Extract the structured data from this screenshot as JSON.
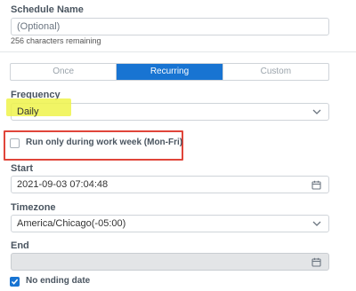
{
  "schedule_name": {
    "label": "Schedule Name",
    "placeholder": "(Optional)",
    "chars_remaining": "256 characters remaining"
  },
  "tabs": [
    {
      "label": "Once",
      "active": false
    },
    {
      "label": "Recurring",
      "active": true
    },
    {
      "label": "Custom",
      "active": false
    }
  ],
  "frequency": {
    "label": "Frequency",
    "value": "Daily",
    "icon": "chevron-down-icon"
  },
  "work_week": {
    "label": "Run only during work week (Mon-Fri)",
    "checked": false
  },
  "start": {
    "label": "Start",
    "value": "2021-09-03 07:04:48",
    "icon": "calendar-icon"
  },
  "timezone": {
    "label": "Timezone",
    "value": "America/Chicago(-05:00)",
    "icon": "chevron-down-icon"
  },
  "end": {
    "label": "End",
    "value": "",
    "disabled": true,
    "icon": "calendar-icon"
  },
  "no_ending_date": {
    "label": "No ending date",
    "checked": true
  },
  "colors": {
    "accent": "#1874d2",
    "highlight": "#eef34a",
    "annotation_red": "#e0453a",
    "disabled_bg": "#e3e5e7"
  }
}
